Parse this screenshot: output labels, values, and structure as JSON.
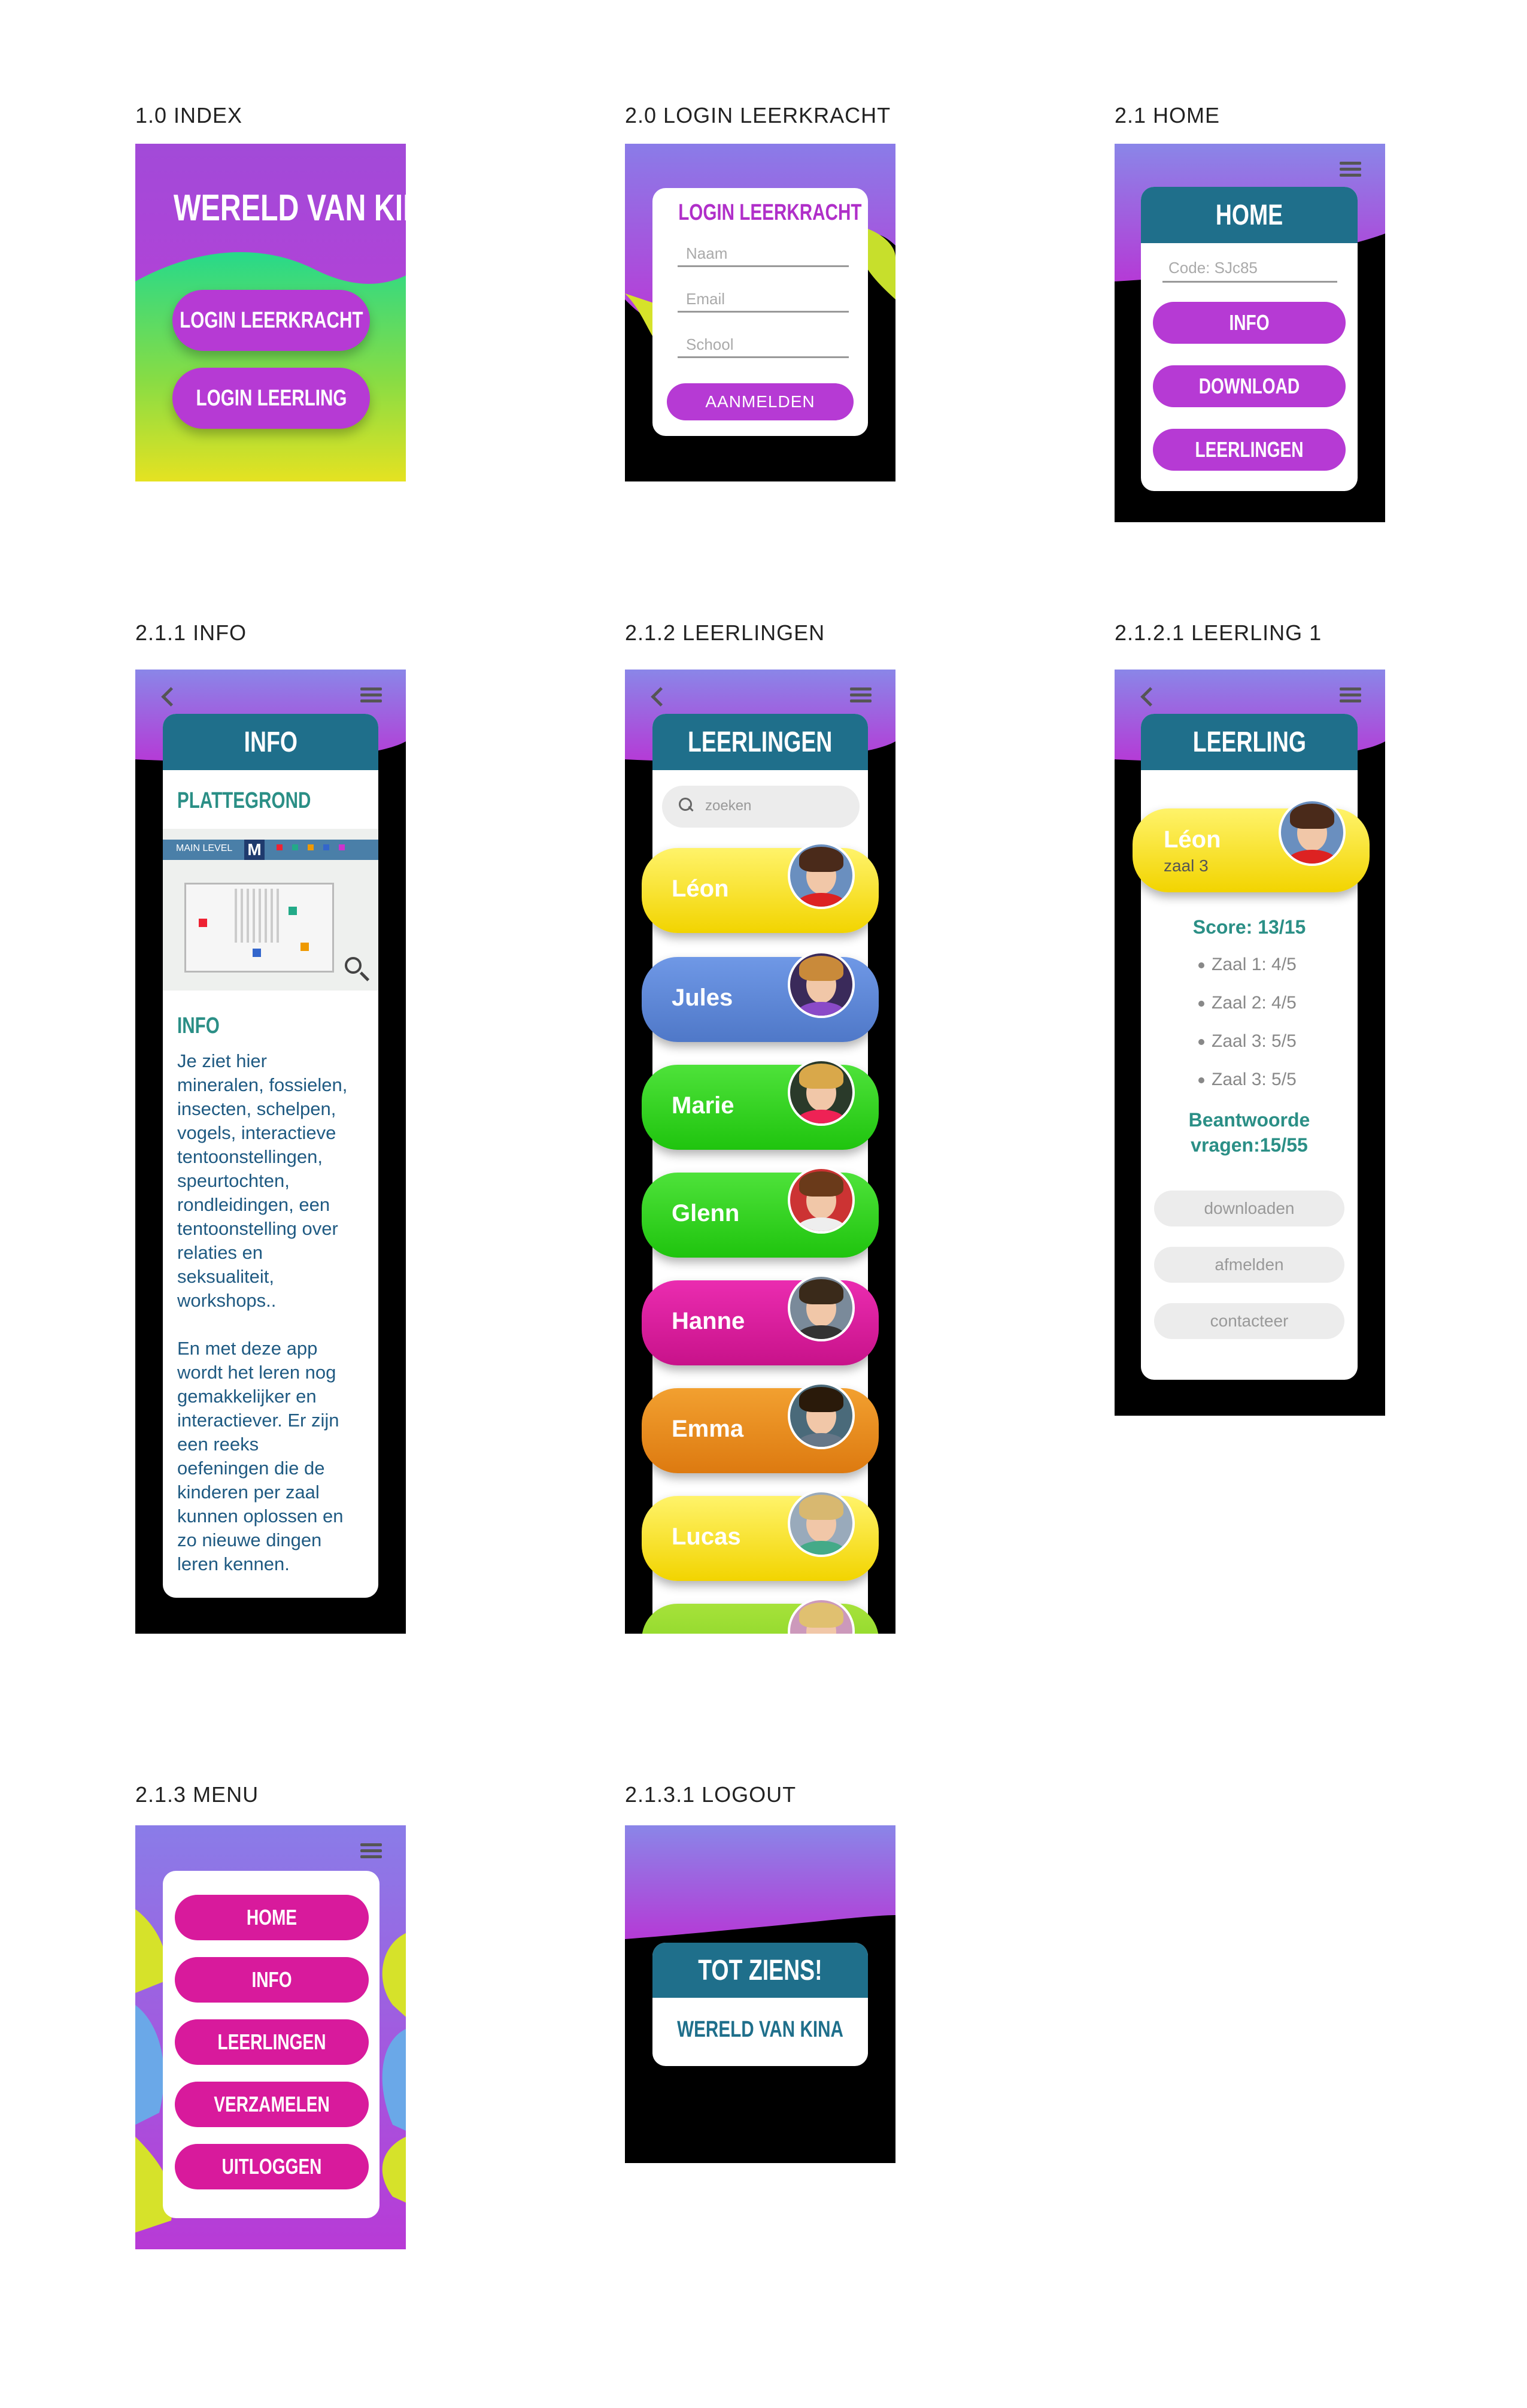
{
  "frames": {
    "index": {
      "label": "1.0 INDEX",
      "title": "WERELD VAN KINA",
      "buttons": [
        "LOGIN LEERKRACHT",
        "LOGIN LEERLING"
      ]
    },
    "login": {
      "label": "2.0 LOGIN LEERKRACHT",
      "title": "LOGIN LEERKRACHT",
      "fields": [
        "Naam",
        "Email",
        "School"
      ],
      "submit": "AANMELDEN"
    },
    "home": {
      "label": "2.1 HOME",
      "title": "HOME",
      "code_placeholder": "Code: SJc85",
      "buttons": [
        "INFO",
        "DOWNLOAD",
        "LEERLINGEN"
      ]
    },
    "info": {
      "label": "2.1.1 INFO",
      "title": "INFO",
      "section1": "PLATTEGROND",
      "map_caption": "MAIN LEVEL",
      "section2": "INFO",
      "paragraph1": "Je ziet hier\nmineralen, fossielen,\ninsecten, schelpen,\nvogels, interactieve\ntentoonstellingen,\nspeurtochten,\nrondleidingen, een\ntentoonstelling over\nrelaties en\nseksualiteit,\nworkshops..",
      "paragraph2": "En met deze app\nwordt het leren nog\ngemakkelijker en\ninteractiever. Er zijn\neen reeks\noefeningen die de\nkinderen per zaal\nkunnen oplossen en\nzo nieuwe dingen\nleren kennen."
    },
    "leerlingen": {
      "label": "2.1.2 LEERLINGEN",
      "title": "LEERLINGEN",
      "search_placeholder": "zoeken",
      "students": [
        {
          "name": "Léon",
          "color": "#f2d400"
        },
        {
          "name": "Jules",
          "color": "#5b86d6"
        },
        {
          "name": "Marie",
          "color": "#2fcf1e"
        },
        {
          "name": "Glenn",
          "color": "#2fcf1e"
        },
        {
          "name": "Hanne",
          "color": "#d81a9c"
        },
        {
          "name": "Emma",
          "color": "#e88a14"
        },
        {
          "name": "Lucas",
          "color": "#f2d400"
        }
      ]
    },
    "leerling": {
      "label": "2.1.2.1 LEERLING 1",
      "title": "LEERLING",
      "name": "Léon",
      "room": "zaal 3",
      "score": "Score: 13/15",
      "zalen": [
        "Zaal 1: 4/5",
        "Zaal 2: 4/5",
        "Zaal 3: 5/5",
        "Zaal 3: 5/5"
      ],
      "answered_line1": "Beantwoorde",
      "answered_line2": "vragen:15/55",
      "buttons": [
        "downloaden",
        "afmelden",
        "contacteer"
      ]
    },
    "menu": {
      "label": "2.1.3 MENU",
      "items": [
        "HOME",
        "INFO",
        "LEERLINGEN",
        "VERZAMELEN",
        "UITLOGGEN"
      ]
    },
    "logout": {
      "label": "2.1.3.1 LOGOUT",
      "title": "TOT ZIENS!",
      "subtitle": "WERELD VAN KINA"
    }
  },
  "colors": {
    "purple": "#b63ad4",
    "teal": "#1f6f8b",
    "magenta": "#d81a9c",
    "green_text": "#2b8f86"
  }
}
